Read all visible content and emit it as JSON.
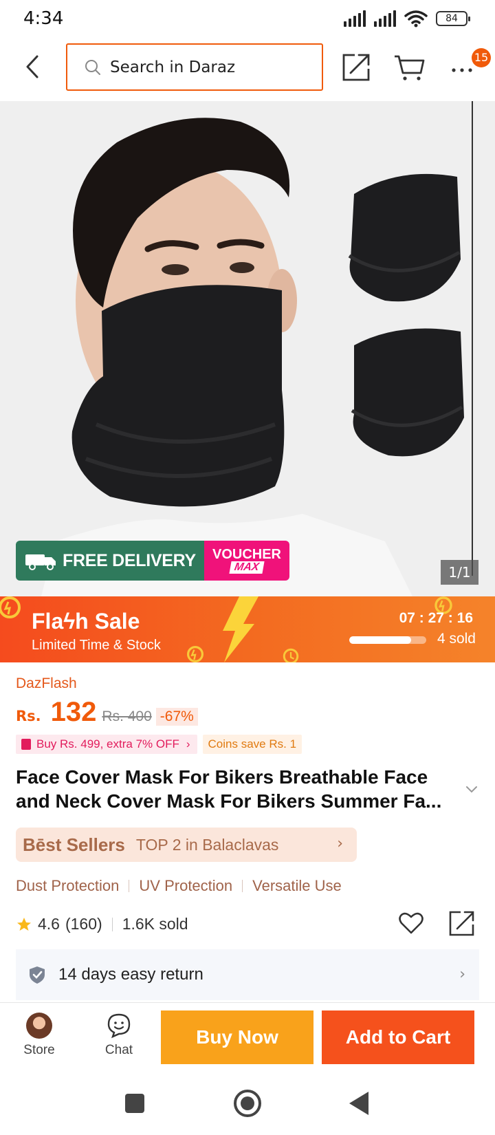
{
  "status_bar": {
    "time": "4:34",
    "battery": "84"
  },
  "header": {
    "search": {
      "placeholder": "Search in Daraz"
    },
    "notification_count": "15",
    "icons": [
      "back-arrow-icon",
      "search-icon",
      "share-icon",
      "cart-icon",
      "more-icon"
    ]
  },
  "gallery": {
    "delivery_banner": {
      "free_tag": "FREE",
      "text": "FREE DELIVERY",
      "voucher_line1": "VOUCHER",
      "voucher_line2": "MAX"
    },
    "counter": "1/1"
  },
  "flash_sale": {
    "title": "Flaϟh  Sale",
    "subtitle": "Limited Time & Stock",
    "countdown": "07 : 27 : 16",
    "sold": "4 sold",
    "progress": 0.8
  },
  "product": {
    "campaign": "DazFlash",
    "currency": "Rs.",
    "price": "132",
    "original_price": "Rs. 400",
    "discount": "-67%",
    "promo": "Buy Rs. 499, extra 7% OFF",
    "coins": "Coins save Rs. 1",
    "title": "Face Cover Mask For Bikers Breathable Face and Neck Cover Mask For Bikers Summer Fa...",
    "best_sellers": {
      "brand": "Bēst Sellers",
      "rank": "TOP 2 in Balaclavas"
    },
    "features": [
      "Dust Protection",
      "UV Protection",
      "Versatile Use"
    ],
    "rating": "4.6",
    "rating_count": "(160)",
    "sold": "1.6K sold",
    "return_policy": "14 days easy return"
  },
  "bottom_bar": {
    "store_label": "Store",
    "chat_label": "Chat",
    "buy_now": "Buy Now",
    "add_to_cart": "Add to Cart"
  },
  "colors": {
    "accent": "#f05a0a",
    "buy_now": "#f9a21b",
    "add_to_cart": "#f5511c",
    "delivery": "#2f7a5c",
    "voucher": "#f0127a"
  }
}
